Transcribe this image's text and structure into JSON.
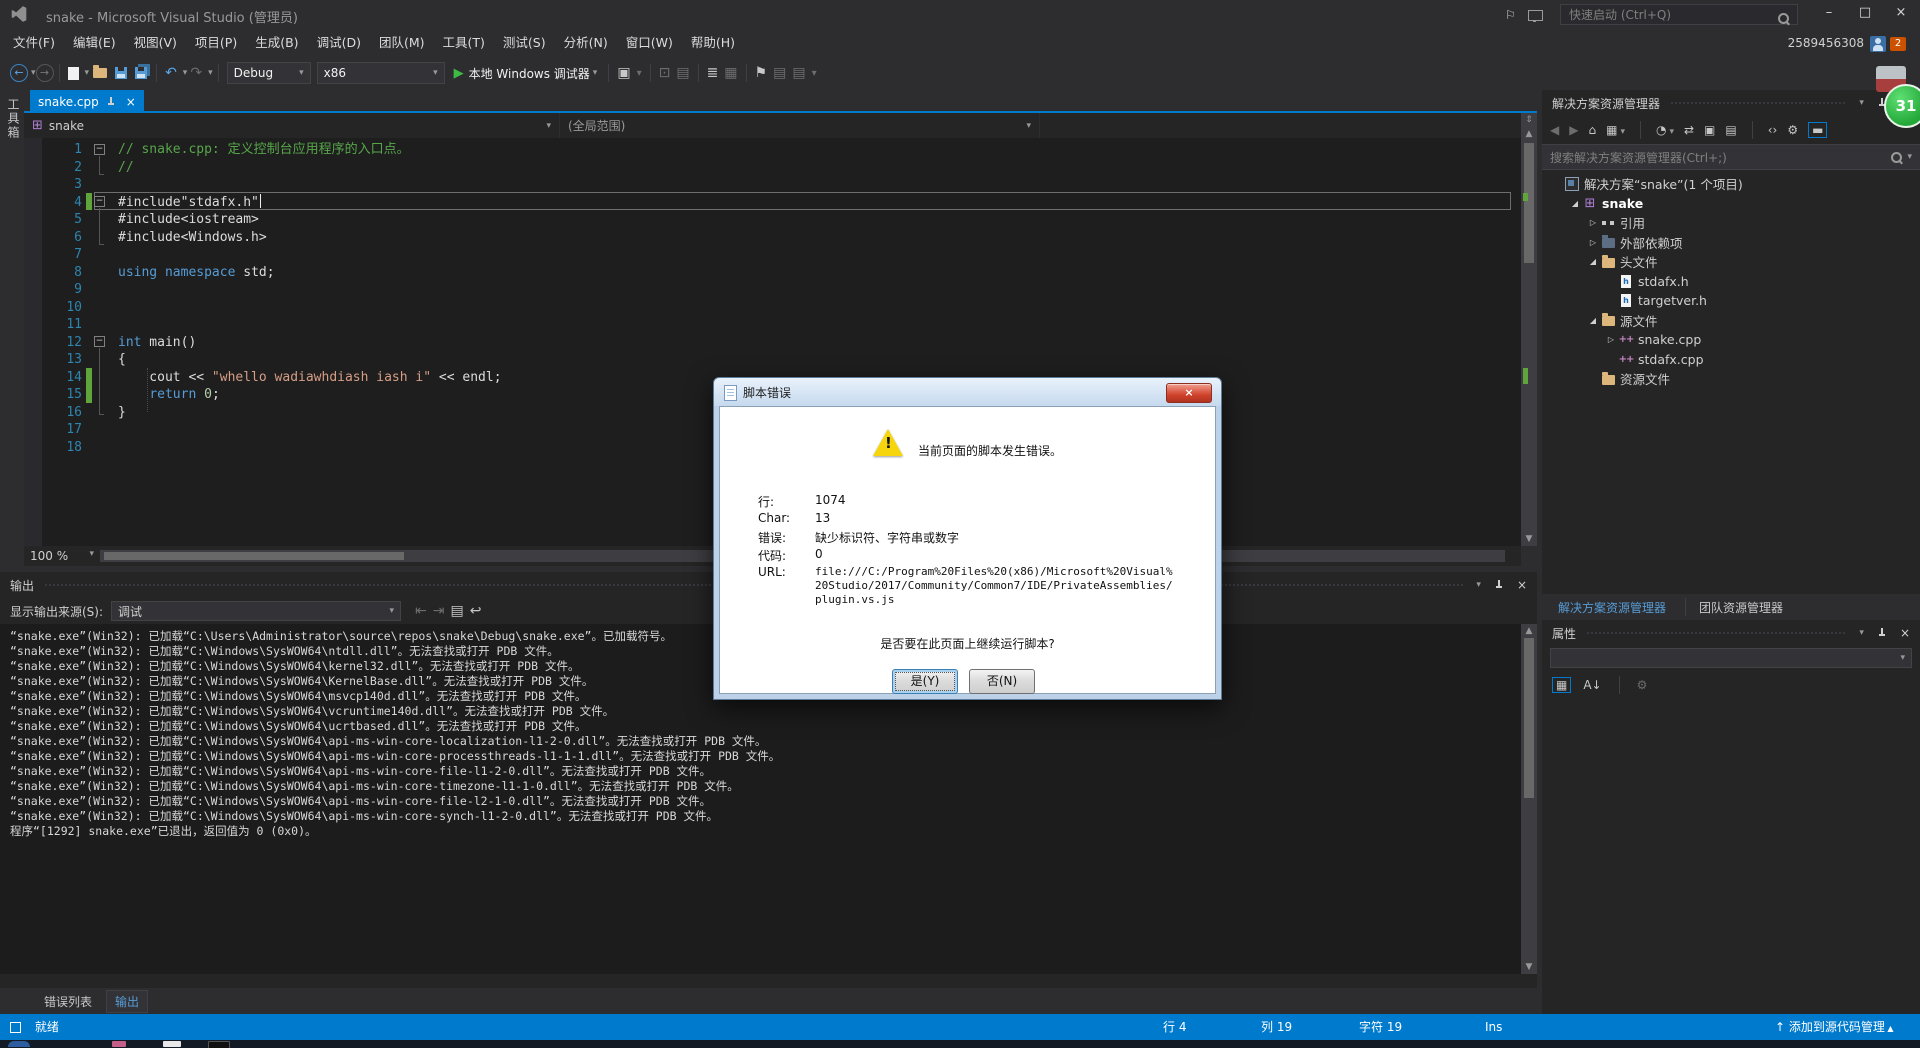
{
  "title_bar": {
    "app_title": "snake - Microsoft Visual Studio (管理员)",
    "quick_launch": "快速启动 (Ctrl+Q)",
    "user_id": "2589456308",
    "notification_count": "2"
  },
  "menu_bar": {
    "items": [
      "文件(F)",
      "编辑(E)",
      "视图(V)",
      "项目(P)",
      "生成(B)",
      "调试(D)",
      "团队(M)",
      "工具(T)",
      "测试(S)",
      "分析(N)",
      "窗口(W)",
      "帮助(H)"
    ]
  },
  "toolbar": {
    "config": "Debug",
    "platform": "x86",
    "debugger_label": "本地 Windows 调试器"
  },
  "editor": {
    "toolbox_tab": "工具箱",
    "doc_tab": "snake.cpp",
    "nav_object": "snake",
    "nav_scope": "(全局范围)",
    "zoom_level": "100 %",
    "code_lines": [
      {
        "n": "1",
        "seg": [
          [
            "c",
            "// snake.cpp: 定义控制台应用程序的入口点。"
          ]
        ]
      },
      {
        "n": "2",
        "seg": [
          [
            "c",
            "//"
          ]
        ]
      },
      {
        "n": "3",
        "seg": []
      },
      {
        "n": "4",
        "seg": [
          [
            "p",
            "#include\"stdafx.h\""
          ]
        ]
      },
      {
        "n": "5",
        "seg": [
          [
            "p",
            "#include<iostream>"
          ]
        ]
      },
      {
        "n": "6",
        "seg": [
          [
            "p",
            "#include<Windows.h>"
          ]
        ]
      },
      {
        "n": "7",
        "seg": []
      },
      {
        "n": "8",
        "seg": [
          [
            "k",
            "using"
          ],
          [
            "p",
            " "
          ],
          [
            "k",
            "namespace"
          ],
          [
            "p",
            " std;"
          ]
        ]
      },
      {
        "n": "9",
        "seg": []
      },
      {
        "n": "10",
        "seg": []
      },
      {
        "n": "11",
        "seg": []
      },
      {
        "n": "12",
        "seg": [
          [
            "k",
            "int"
          ],
          [
            "p",
            " main()"
          ]
        ]
      },
      {
        "n": "13",
        "seg": [
          [
            "p",
            "{"
          ]
        ]
      },
      {
        "n": "14",
        "seg": [
          [
            "p",
            "    cout << "
          ],
          [
            "s",
            "\"whello wadiawhdiash iash i\""
          ],
          [
            "p",
            " << endl;"
          ]
        ]
      },
      {
        "n": "15",
        "seg": [
          [
            "p",
            "    "
          ],
          [
            "k",
            "return"
          ],
          [
            "p",
            " "
          ],
          [
            "n2",
            "0"
          ],
          [
            "p",
            ";"
          ]
        ]
      },
      {
        "n": "16",
        "seg": [
          [
            "p",
            "}"
          ]
        ]
      },
      {
        "n": "17",
        "seg": []
      },
      {
        "n": "18",
        "seg": []
      }
    ]
  },
  "dialog": {
    "title": "脚本错误",
    "message": "当前页面的脚本发生错误。",
    "fields": [
      {
        "label": "行:",
        "value": "1074"
      },
      {
        "label": "Char:",
        "value": "13"
      },
      {
        "label": "错误:",
        "value": "缺少标识符、字符串或数字"
      },
      {
        "label": "代码:",
        "value": "0"
      },
      {
        "label": "URL:",
        "value": "file:///C:/Program%20Files%20(x86)/Microsoft%20Visual%20Studio/2017/Community/Common7/IDE/PrivateAssemblies/plugin.vs.js"
      }
    ],
    "question": "是否要在此页面上继续运行脚本?",
    "yes_button": "是(Y)",
    "no_button": "否(N)"
  },
  "solution_explorer": {
    "title": "解决方案资源管理器",
    "search_placeholder": "搜索解决方案资源管理器(Ctrl+;)",
    "tree": [
      {
        "indent": 0,
        "exp": "",
        "icon": "solution",
        "label": "解决方案“snake”(1 个项目)",
        "bold": false
      },
      {
        "indent": 1,
        "exp": "open",
        "icon": "vcproj",
        "label": "snake",
        "bold": true
      },
      {
        "indent": 2,
        "exp": "closed",
        "icon": "refs",
        "label": "引用",
        "bold": false
      },
      {
        "indent": 2,
        "exp": "closed",
        "icon": "extfolder",
        "label": "外部依赖项",
        "bold": false
      },
      {
        "indent": 2,
        "exp": "open",
        "icon": "folder",
        "label": "头文件",
        "bold": false
      },
      {
        "indent": 3,
        "exp": "",
        "icon": "hfile",
        "label": "stdafx.h",
        "bold": false
      },
      {
        "indent": 3,
        "exp": "",
        "icon": "hfile",
        "label": "targetver.h",
        "bold": false
      },
      {
        "indent": 2,
        "exp": "open",
        "icon": "folder",
        "label": "源文件",
        "bold": false
      },
      {
        "indent": 3,
        "exp": "closed",
        "icon": "cppfile",
        "label": "snake.cpp",
        "bold": false
      },
      {
        "indent": 3,
        "exp": "",
        "icon": "cppfile",
        "label": "stdafx.cpp",
        "bold": false
      },
      {
        "indent": 2,
        "exp": "",
        "icon": "folder",
        "label": "资源文件",
        "bold": false
      }
    ],
    "tabs": {
      "solution": "解决方案资源管理器",
      "team": "团队资源管理器"
    }
  },
  "properties_panel": {
    "title": "属性"
  },
  "output_panel": {
    "title": "输出",
    "source_label": "显示输出来源(S):",
    "source_value": "调试",
    "lines": [
      "“snake.exe”(Win32): 已加载“C:\\Users\\Administrator\\source\\repos\\snake\\Debug\\snake.exe”。已加载符号。",
      "“snake.exe”(Win32): 已加载“C:\\Windows\\SysWOW64\\ntdll.dll”。无法查找或打开 PDB 文件。",
      "“snake.exe”(Win32): 已加载“C:\\Windows\\SysWOW64\\kernel32.dll”。无法查找或打开 PDB 文件。",
      "“snake.exe”(Win32): 已加载“C:\\Windows\\SysWOW64\\KernelBase.dll”。无法查找或打开 PDB 文件。",
      "“snake.exe”(Win32): 已加载“C:\\Windows\\SysWOW64\\msvcp140d.dll”。无法查找或打开 PDB 文件。",
      "“snake.exe”(Win32): 已加载“C:\\Windows\\SysWOW64\\vcruntime140d.dll”。无法查找或打开 PDB 文件。",
      "“snake.exe”(Win32): 已加载“C:\\Windows\\SysWOW64\\ucrtbased.dll”。无法查找或打开 PDB 文件。",
      "“snake.exe”(Win32): 已加载“C:\\Windows\\SysWOW64\\api-ms-win-core-localization-l1-2-0.dll”。无法查找或打开 PDB 文件。",
      "“snake.exe”(Win32): 已加载“C:\\Windows\\SysWOW64\\api-ms-win-core-processthreads-l1-1-1.dll”。无法查找或打开 PDB 文件。",
      "“snake.exe”(Win32): 已加载“C:\\Windows\\SysWOW64\\api-ms-win-core-file-l1-2-0.dll”。无法查找或打开 PDB 文件。",
      "“snake.exe”(Win32): 已加载“C:\\Windows\\SysWOW64\\api-ms-win-core-timezone-l1-1-0.dll”。无法查找或打开 PDB 文件。",
      "“snake.exe”(Win32): 已加载“C:\\Windows\\SysWOW64\\api-ms-win-core-file-l2-1-0.dll”。无法查找或打开 PDB 文件。",
      "“snake.exe”(Win32): 已加载“C:\\Windows\\SysWOW64\\api-ms-win-core-synch-l1-2-0.dll”。无法查找或打开 PDB 文件。",
      "程序“[1292] snake.exe”已退出，返回值为 0 (0x0)。"
    ]
  },
  "bottom_tabs": {
    "error_list": "错误列表",
    "output": "输出"
  },
  "status_bar": {
    "ready": "就绪",
    "line": "行 4",
    "column": "列 19",
    "character": "字符 19",
    "mode": "Ins",
    "source_control": "添加到源代码管理"
  },
  "overlay": {
    "count": "31"
  }
}
